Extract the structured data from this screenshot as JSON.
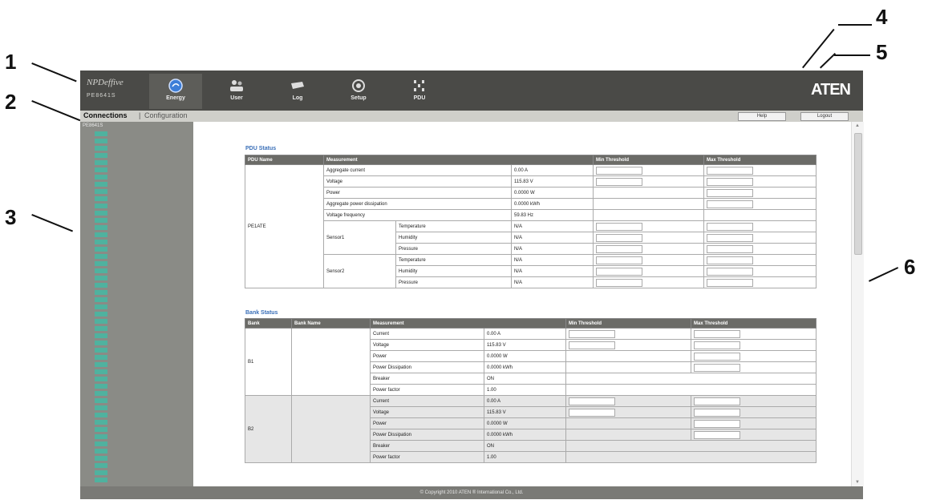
{
  "callouts": [
    "1",
    "2",
    "3",
    "4",
    "5",
    "6"
  ],
  "header": {
    "brand_line1": "NPDeffive",
    "brand_line2": "PE8641S",
    "nav": [
      {
        "label": "Energy",
        "icon": "energy-icon"
      },
      {
        "label": "User",
        "icon": "user-icon"
      },
      {
        "label": "Log",
        "icon": "log-icon"
      },
      {
        "label": "Setup",
        "icon": "setup-icon"
      },
      {
        "label": "PDU",
        "icon": "pdu-icon"
      }
    ],
    "logo": "ATEN"
  },
  "subbar": {
    "tab_connections": "Connections",
    "separator": "|",
    "tab_configuration": "Configuration",
    "help_label": "Help",
    "logout_label": "Logout"
  },
  "sidebar": {
    "title": "PE8641S"
  },
  "pdu_status": {
    "title": "PDU Status",
    "headers": [
      "PDU Name",
      "Measurement",
      "Min Threshold",
      "Max Threshold"
    ],
    "pdu_name": "PE1ATE",
    "rows": [
      {
        "label": "Aggregate current",
        "value": "0.00 A"
      },
      {
        "label": "Voltage",
        "value": "115.83 V"
      },
      {
        "label": "Power",
        "value": "0.0000 W"
      },
      {
        "label": "Aggregate power dissipation",
        "value": "0.0000 kWh"
      },
      {
        "label": "Voltage frequency",
        "value": "59.83 Hz"
      }
    ],
    "sensors": [
      {
        "name": "Sensor1",
        "rows": [
          {
            "label": "Temperature",
            "value": "N/A"
          },
          {
            "label": "Humidity",
            "value": "N/A"
          },
          {
            "label": "Pressure",
            "value": "N/A"
          }
        ]
      },
      {
        "name": "Sensor2",
        "rows": [
          {
            "label": "Temperature",
            "value": "N/A"
          },
          {
            "label": "Humidity",
            "value": "N/A"
          },
          {
            "label": "Pressure",
            "value": "N/A"
          }
        ]
      }
    ]
  },
  "bank_status": {
    "title": "Bank Status",
    "headers": [
      "Bank",
      "Bank Name",
      "Measurement",
      "Min Threshold",
      "Max Threshold"
    ],
    "banks": [
      {
        "bank": "B1",
        "name": "",
        "rows": [
          {
            "label": "Current",
            "value": "0.00 A"
          },
          {
            "label": "Voltage",
            "value": "115.83 V"
          },
          {
            "label": "Power",
            "value": "0.0000 W"
          },
          {
            "label": "Power Dissipation",
            "value": "0.0000 kWh"
          },
          {
            "label": "Breaker",
            "value": "ON"
          },
          {
            "label": "Power factor",
            "value": "1.00"
          }
        ]
      },
      {
        "bank": "B2",
        "name": "",
        "rows": [
          {
            "label": "Current",
            "value": "0.00 A"
          },
          {
            "label": "Voltage",
            "value": "115.83 V"
          },
          {
            "label": "Power",
            "value": "0.0000 W"
          },
          {
            "label": "Power Dissipation",
            "value": "0.0000 kWh"
          },
          {
            "label": "Breaker",
            "value": "ON"
          },
          {
            "label": "Power factor",
            "value": "1.00"
          }
        ]
      }
    ]
  },
  "footer": {
    "text": "© Copyright 2010 ATEN ® International Co., Ltd."
  }
}
